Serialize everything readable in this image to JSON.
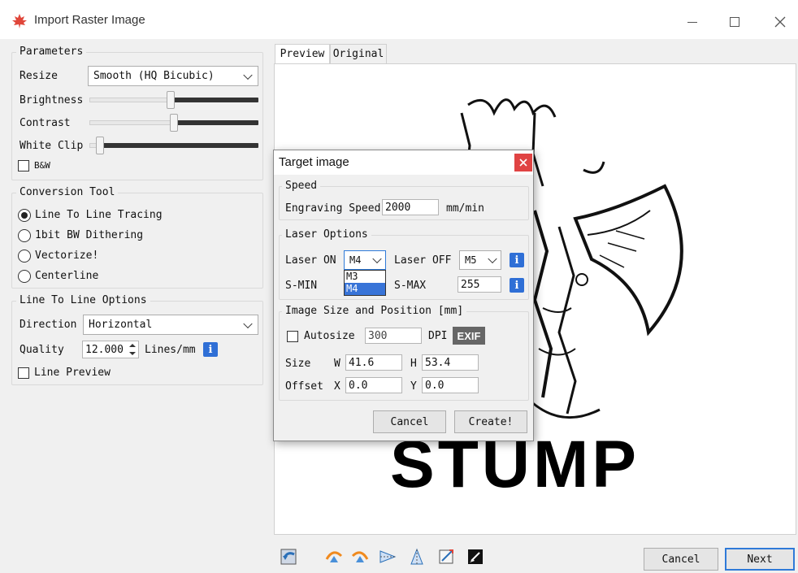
{
  "window": {
    "title": "Import Raster Image"
  },
  "parameters": {
    "title": "Parameters",
    "resize_label": "Resize",
    "resize_value": "Smooth (HQ Bicubic)",
    "brightness_label": "Brightness",
    "contrast_label": "Contrast",
    "whiteclip_label": "White Clip",
    "bw_label": "B&W",
    "brightness_level": 0.48,
    "contrast_level": 0.5,
    "whiteclip_level": 0.06
  },
  "conversion": {
    "title": "Conversion Tool",
    "options": [
      "Line To Line Tracing",
      "1bit BW Dithering",
      "Vectorize!",
      "Centerline"
    ],
    "selected": "Line To Line Tracing"
  },
  "line_options": {
    "title": "Line To Line Options",
    "direction_label": "Direction",
    "direction_value": "Horizontal",
    "quality_label": "Quality",
    "quality_value": "12.000",
    "quality_unit": "Lines/mm",
    "line_preview_label": "Line Preview"
  },
  "tabs": [
    "Preview",
    "Original"
  ],
  "preview": {
    "stump_text": "STUMP"
  },
  "dialog": {
    "title": "Target image",
    "speed_title": "Speed",
    "engraving_speed_label": "Engraving Speed",
    "engraving_speed_value": "2000",
    "speed_unit": "mm/min",
    "laser_title": "Laser Options",
    "laser_on_label": "Laser ON",
    "laser_on_value": "M4",
    "laser_on_options": [
      "M3",
      "M4"
    ],
    "laser_off_label": "Laser OFF",
    "laser_off_value": "M5",
    "smin_label": "S-MIN",
    "smax_label": "S-MAX",
    "smax_value": "255",
    "size_title": "Image Size and Position [mm]",
    "autosize_label": "Autosize",
    "dpi_value": "300",
    "dpi_label": "DPI",
    "exif_label": "EXIF",
    "size_label": "Size",
    "w_label": "W",
    "w_value": "41.6",
    "h_label": "H",
    "h_value": "53.4",
    "offset_label": "Offset",
    "x_label": "X",
    "x_value": "0.0",
    "y_label": "Y",
    "y_value": "0.0",
    "cancel_label": "Cancel",
    "create_label": "Create!"
  },
  "footer": {
    "cancel_label": "Cancel",
    "next_label": "Next"
  },
  "colors": {
    "accent": "#2f7ad8",
    "info": "#2f6fd6",
    "close": "#e04343",
    "selection": "#3874d8"
  }
}
